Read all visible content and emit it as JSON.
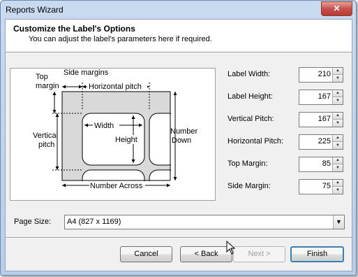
{
  "window": {
    "title": "Reports Wizard",
    "close_glyph": "✕"
  },
  "header": {
    "title": "Customize the Label's Options",
    "subtitle": "You can adjust the label's parameters here if required."
  },
  "diagram": {
    "top_margin_line1": "Top",
    "top_margin_line2": "margin",
    "side_margins": "Side margins",
    "horizontal_pitch": "Horizontal pitch",
    "width": "Width",
    "height": "Height",
    "vertical_pitch_line1": "Vertical",
    "vertical_pitch_line2": "pitch",
    "number_down_line1": "Number",
    "number_down_line2": "Down",
    "number_across": "Number Across"
  },
  "fields": [
    {
      "label": "Label Width:",
      "value": "210"
    },
    {
      "label": "Label Height:",
      "value": "167"
    },
    {
      "label": "Vertical Pitch:",
      "value": "167"
    },
    {
      "label": "Horizontal Pitch:",
      "value": "225"
    },
    {
      "label": "Top Margin:",
      "value": "85"
    },
    {
      "label": "Side Margin:",
      "value": "75"
    }
  ],
  "page_size": {
    "label": "Page Size:",
    "value": "A4 (827 x 1169)"
  },
  "buttons": {
    "cancel": "Cancel",
    "back": "< Back",
    "next": "Next >",
    "finish": "Finish"
  },
  "icons": {
    "spin_up": "▲",
    "spin_down": "▼",
    "dropdown": "▼"
  }
}
